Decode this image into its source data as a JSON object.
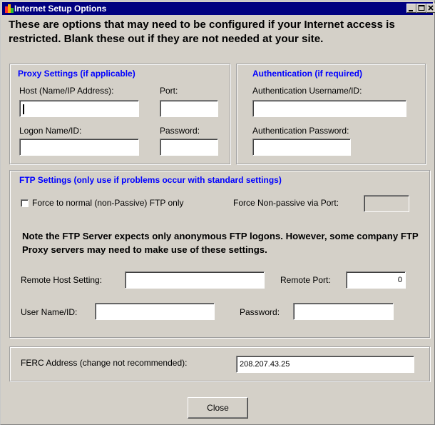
{
  "window": {
    "title": "Internet Setup Options",
    "controls": {
      "minimize": "_",
      "maximize": "□",
      "close": "×"
    }
  },
  "intro_text": "These are options that may need to be configured if your Internet access is restricted. Blank these out if they are not needed at your site.",
  "proxy": {
    "title": "Proxy Settings (if applicable)",
    "host_label": "Host (Name/IP Address):",
    "host_value": "",
    "port_label": "Port:",
    "port_value": "",
    "logon_label": "Logon Name/ID:",
    "logon_value": "",
    "password_label": "Password:",
    "password_value": ""
  },
  "auth": {
    "title": "Authentication (if required)",
    "username_label": "Authentication Username/ID:",
    "username_value": "",
    "password_label": "Authentication Password:",
    "password_value": ""
  },
  "ftp": {
    "title": "FTP Settings (only use if problems occur with standard settings)",
    "force_normal_label": "Force to normal (non-Passive) FTP only",
    "force_normal_checked": false,
    "force_port_label": "Force Non-passive via Port:",
    "force_port_value": "",
    "note": "Note the FTP Server expects only anonymous FTP logons. However, some company FTP Proxy servers may need to make use of these settings.",
    "remote_host_label": "Remote Host Setting:",
    "remote_host_value": "",
    "remote_port_label": "Remote Port:",
    "remote_port_value": "0",
    "username_label": "User Name/ID:",
    "username_value": "",
    "password_label": "Password:",
    "password_value": ""
  },
  "ferc": {
    "label": "FERC Address (change not recommended):",
    "value": "208.207.43.25"
  },
  "close_button": "Close",
  "colors": {
    "title_bar": "#00007f",
    "window_bg": "#d4d0c8",
    "section_title": "#0000ff"
  }
}
